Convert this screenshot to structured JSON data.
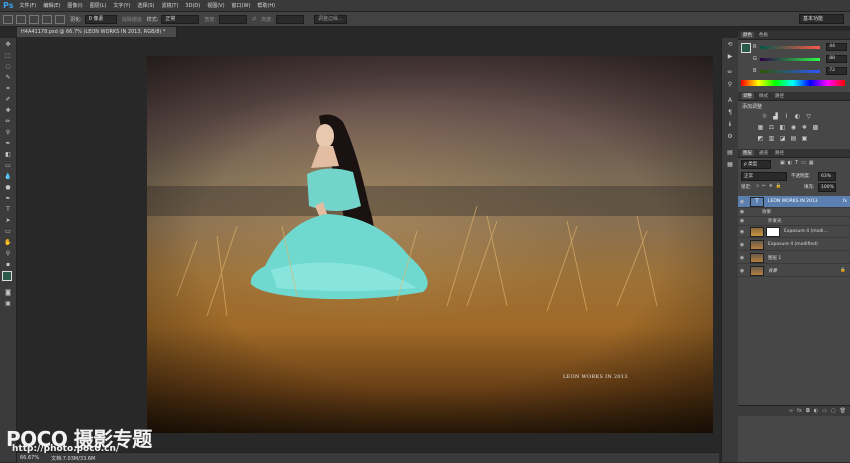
{
  "app": {
    "logo": "Ps"
  },
  "menu": [
    "文件(F)",
    "编辑(E)",
    "图像(I)",
    "图层(L)",
    "文字(Y)",
    "选择(S)",
    "滤镜(T)",
    "3D(D)",
    "视图(V)",
    "窗口(W)",
    "帮助(H)"
  ],
  "options": {
    "feather_label": "羽化:",
    "feather_value": "0 像素",
    "antialias_label": "消除锯齿",
    "style_label": "样式:",
    "style_value": "正常",
    "width_label": "宽度:",
    "height_label": "高度:",
    "refine_button": "调整边缘...",
    "workspace": "基本功能"
  },
  "document": {
    "tab_title": "H4A41178.psd @ 66.7% (LEON WORKS IN 2013, RGB/8) *",
    "watermark": "LEON WORKS IN 2013"
  },
  "status": {
    "zoom": "66.67%",
    "doc_info": "文档:7.03M/33.6M"
  },
  "branding": {
    "logo_text": "POCO 摄影专题",
    "url": "http://photo.poco.cn/"
  },
  "color_panel": {
    "tabs": [
      "颜色",
      "色板"
    ],
    "r_label": "R",
    "r_value": "44",
    "g_label": "G",
    "g_value": "88",
    "b_label": "B",
    "b_value": "72"
  },
  "adjust_panel": {
    "tabs": [
      "调整",
      "样式",
      "路径"
    ],
    "title": "添加调整"
  },
  "layers_panel": {
    "tabs": [
      "图层",
      "通道",
      "路径"
    ],
    "filter_label": "ρ 类型",
    "blend_mode": "正常",
    "opacity_label": "不透明度:",
    "opacity_value": "63%",
    "lock_label": "锁定:",
    "fill_label": "填充:",
    "fill_value": "100%",
    "layers": [
      {
        "name": "LEON WORKS IN 2013",
        "type": "text",
        "fx": "fx"
      },
      {
        "name": "效果",
        "type": "effect"
      },
      {
        "name": "外发光",
        "type": "effect"
      },
      {
        "name": "Exposure 4 (modi...",
        "type": "adjust"
      },
      {
        "name": "Exposure 4 (modified)",
        "type": "image"
      },
      {
        "name": "图层 1",
        "type": "image"
      },
      {
        "name": "背景",
        "type": "image"
      }
    ]
  }
}
